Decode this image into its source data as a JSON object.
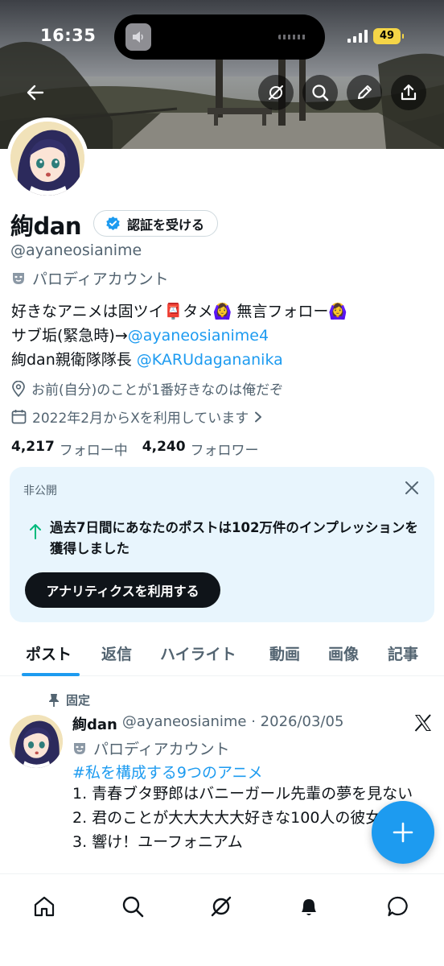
{
  "status_bar": {
    "time": "16:35",
    "battery": "49"
  },
  "profile": {
    "name": "絢dan",
    "verify_button": "認証を受ける",
    "handle": "@ayaneosianime",
    "parody_label": "パロディアカウント",
    "bio": {
      "line1": "好きなアニメは固ツイ📮タメ🙆‍♀️ 無言フォロー🙆‍♀️",
      "line2_prefix": "サブ垢(緊急時)→",
      "line2_link": "@ayaneosianime4",
      "line3_prefix": "絢dan親衛隊隊長 ",
      "line3_link": "@KARUdagananika"
    },
    "location": "お前(自分)のことが1番好きなのは俺だぞ",
    "joined": "2022年2月からXを利用しています",
    "following_count": "4,217",
    "following_label": "フォロー中",
    "followers_count": "4,240",
    "followers_label": "フォロワー"
  },
  "private_card": {
    "label": "非公開",
    "text": "過去7日間にあなたのポストは102万件のインプレッションを獲得しました",
    "button": "アナリティクスを利用する"
  },
  "tabs": [
    {
      "label": "ポスト"
    },
    {
      "label": "返信"
    },
    {
      "label": "ハイライト"
    },
    {
      "label": "動画"
    },
    {
      "label": "画像"
    },
    {
      "label": "記事"
    }
  ],
  "pinned_post": {
    "pinned_label": "固定",
    "author": "絢dan",
    "handle_date": "@ayaneosianime · 2026/03/05",
    "parody_label": "パロディアカウント",
    "hashtag": "#私を構成する9つのアニメ",
    "lines": [
      "1. 青春ブタ野郎はバニーガール先輩の夢を見ない",
      "2. 君のことが大大大大大好きな100人の彼女",
      "3. 響け！ユーフォニアム"
    ]
  },
  "icons": {
    "back": "arrow-left-icon",
    "grok": "grok-icon",
    "search": "search-icon",
    "edit": "pencil-icon",
    "share": "share-icon",
    "close": "close-icon",
    "arrow_up": "arrow-up-icon",
    "pin": "pin-icon",
    "x_logo": "x-logo-icon",
    "compose": "plus-icon",
    "nav": [
      "home-icon",
      "search-icon",
      "grok-icon",
      "bell-icon",
      "messages-icon"
    ]
  },
  "colors": {
    "accent": "#1d9bf0",
    "card_bg": "#e8f5fd",
    "text_secondary": "#536471"
  }
}
